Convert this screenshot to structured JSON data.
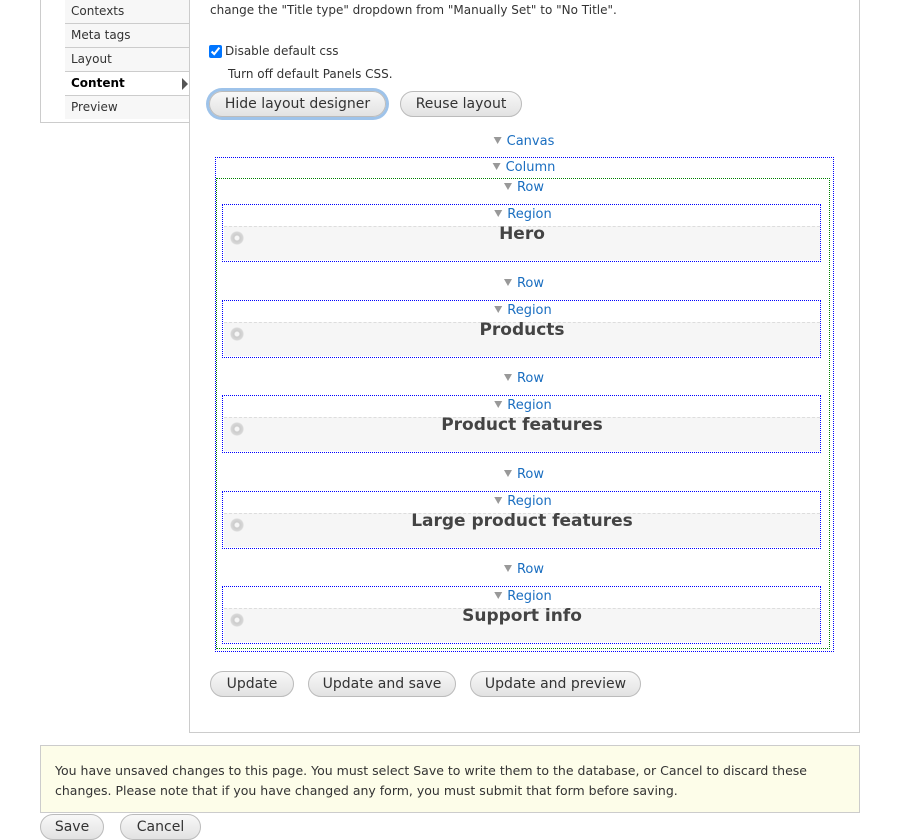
{
  "sidebar": {
    "items": [
      {
        "label": "Contexts"
      },
      {
        "label": "Meta tags"
      },
      {
        "label": "Layout"
      },
      {
        "label": "Content",
        "active": true
      },
      {
        "label": "Preview"
      }
    ]
  },
  "intro_text": "change the \"Title type\" dropdown from \"Manually Set\" to \"No Title\".",
  "disable_css": {
    "label": "Disable default css",
    "checked": true,
    "description": "Turn off default Panels CSS."
  },
  "buttons": {
    "hide_layout": "Hide layout designer",
    "reuse_layout": "Reuse layout",
    "update": "Update",
    "update_save": "Update and save",
    "update_preview": "Update and preview",
    "save": "Save",
    "cancel": "Cancel"
  },
  "layout": {
    "canvas": "Canvas",
    "column": "Column",
    "row_label": "Row",
    "region_label": "Region",
    "regions": [
      "Hero",
      "Products",
      "Product features",
      "Large product features",
      "Support info"
    ]
  },
  "message": "You have unsaved changes to this page. You must select Save to write them to the database, or Cancel to discard these changes. Please note that if you have changed any form, you must submit that form before saving.",
  "colors": {
    "link": "#1a6ec0",
    "column_border": "#0000ff",
    "row_border": "#008000",
    "message_bg": "#fdfde9"
  }
}
